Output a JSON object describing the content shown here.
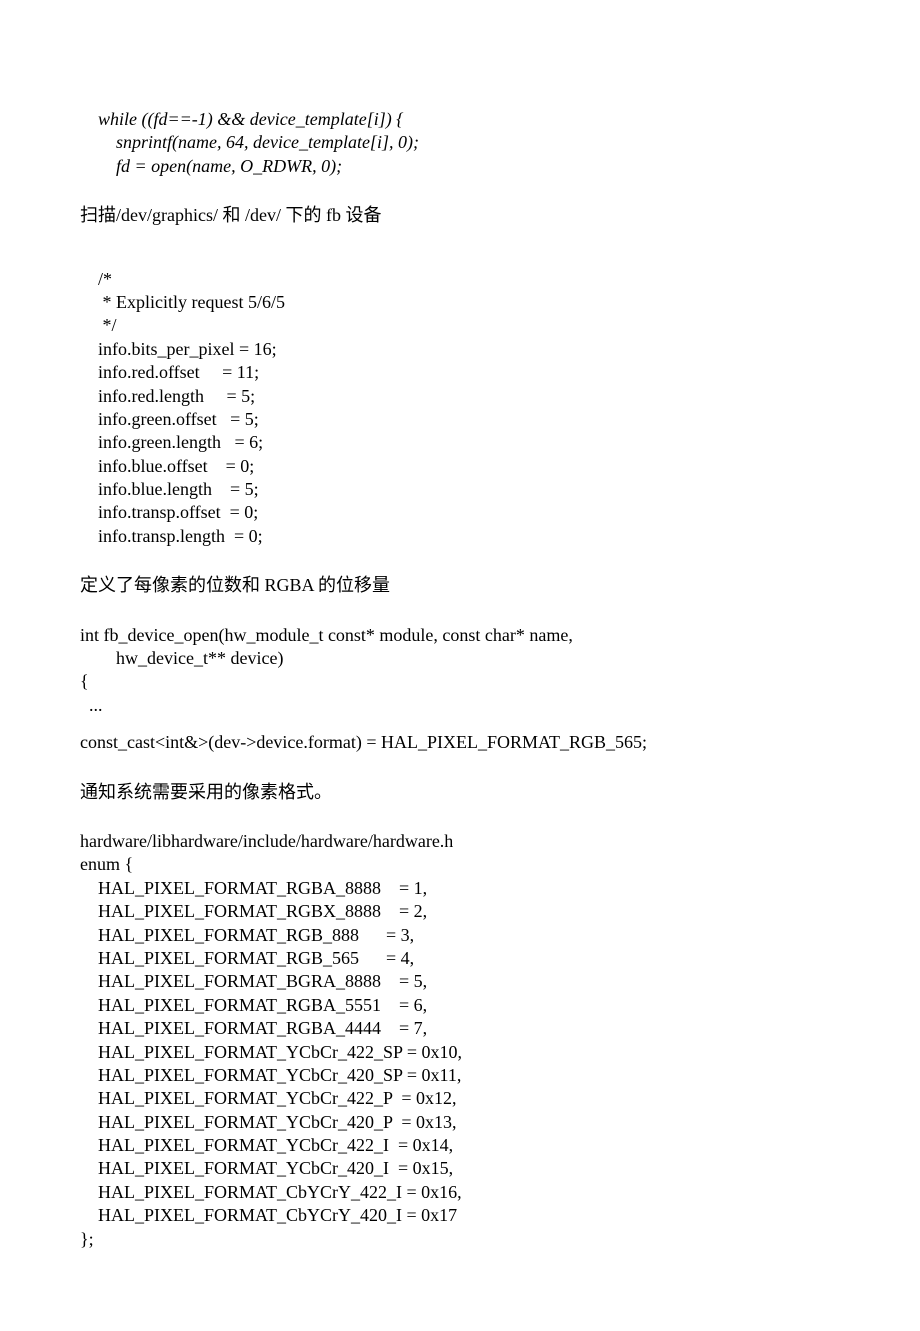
{
  "block1": {
    "code": "    while ((fd==-1) && device_template[i]) {\n        snprintf(name, 64, device_template[i], 0);\n        fd = open(name, O_RDWR, 0);"
  },
  "note1": "扫描/dev/graphics/ 和 /dev/ 下的 fb 设备",
  "block2": {
    "code": "    /*\n     * Explicitly request 5/6/5\n     */\n    info.bits_per_pixel = 16;\n    info.red.offset     = 11;\n    info.red.length     = 5;\n    info.green.offset   = 5;\n    info.green.length   = 6;\n    info.blue.offset    = 0;\n    info.blue.length    = 5;\n    info.transp.offset  = 0;\n    info.transp.length  = 0;"
  },
  "note2": "定义了每像素的位数和 RGBA 的位移量",
  "block3": {
    "code": "int fb_device_open(hw_module_t const* module, const char* name,\n        hw_device_t** device)\n{\n  ..."
  },
  "const_cast_line": "const_cast<int&>(dev->device.format) = HAL_PIXEL_FORMAT_RGB_565;",
  "note3": "通知系统需要采用的像素格式。",
  "block4": {
    "code": "hardware/libhardware/include/hardware/hardware.h\nenum {\n    HAL_PIXEL_FORMAT_RGBA_8888    = 1,\n    HAL_PIXEL_FORMAT_RGBX_8888    = 2,\n    HAL_PIXEL_FORMAT_RGB_888      = 3,\n    HAL_PIXEL_FORMAT_RGB_565      = 4,\n    HAL_PIXEL_FORMAT_BGRA_8888    = 5,\n    HAL_PIXEL_FORMAT_RGBA_5551    = 6,\n    HAL_PIXEL_FORMAT_RGBA_4444    = 7,\n    HAL_PIXEL_FORMAT_YCbCr_422_SP = 0x10,\n    HAL_PIXEL_FORMAT_YCbCr_420_SP = 0x11,\n    HAL_PIXEL_FORMAT_YCbCr_422_P  = 0x12,\n    HAL_PIXEL_FORMAT_YCbCr_420_P  = 0x13,\n    HAL_PIXEL_FORMAT_YCbCr_422_I  = 0x14,\n    HAL_PIXEL_FORMAT_YCbCr_420_I  = 0x15,\n    HAL_PIXEL_FORMAT_CbYCrY_422_I = 0x16,\n    HAL_PIXEL_FORMAT_CbYCrY_420_I = 0x17\n};"
  }
}
